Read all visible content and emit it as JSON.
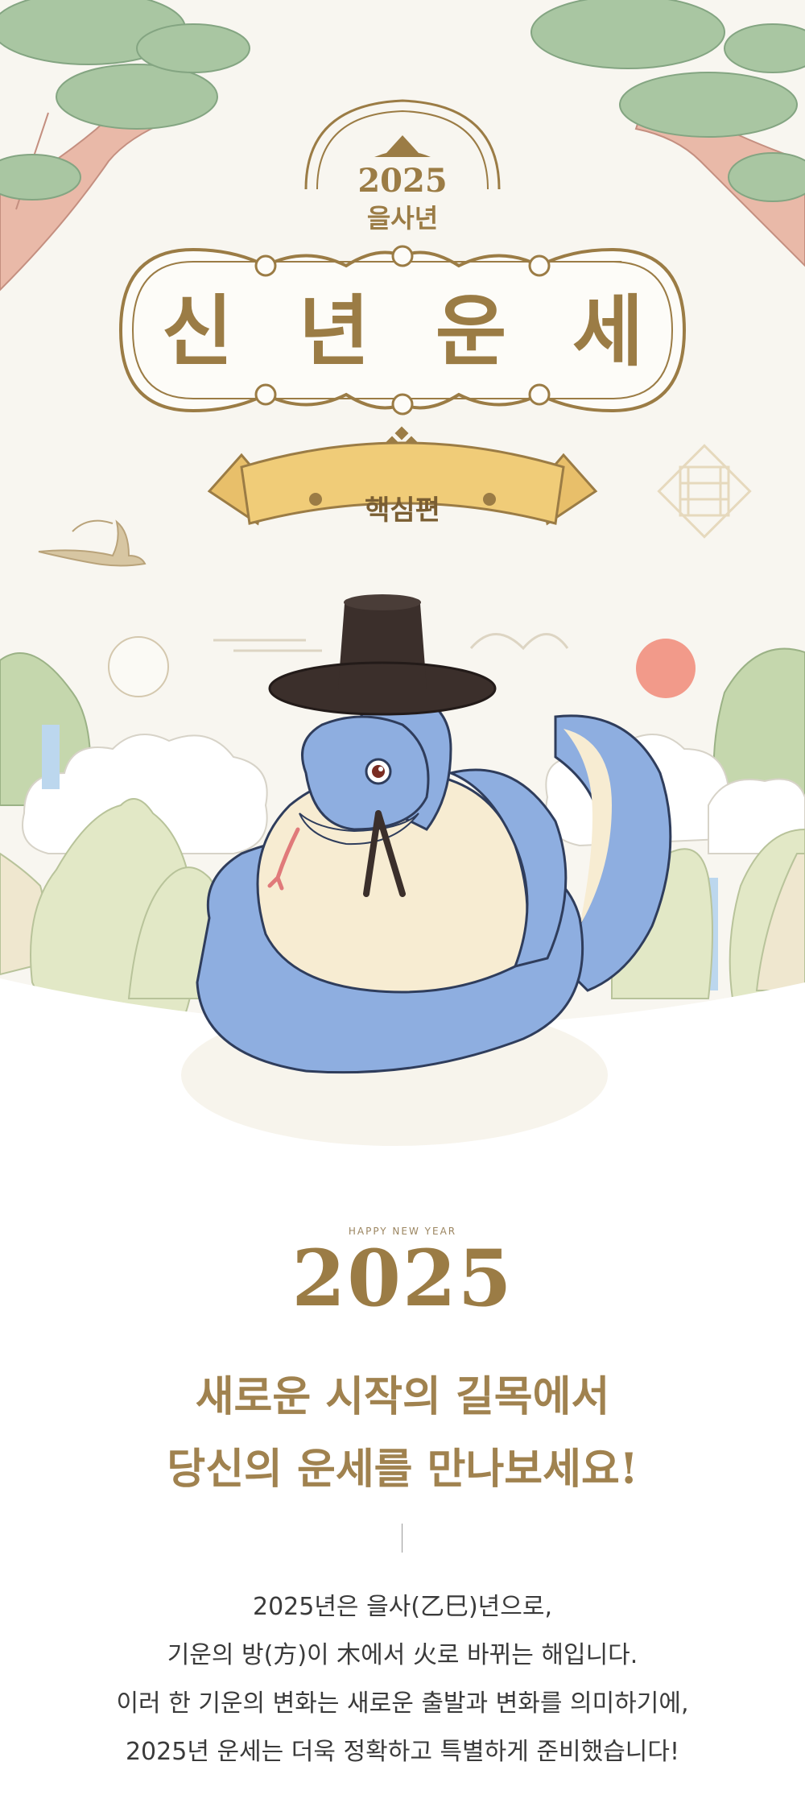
{
  "hero": {
    "year_badge": "2025",
    "zodiac_year": "을사년",
    "title_chars": [
      "신",
      "년",
      "운",
      "세"
    ],
    "ribbon_label": "핵심편"
  },
  "intro": {
    "happy_new_year": "HAPPY NEW YEAR",
    "year": "2025",
    "headline_line1": "새로운 시작의 길목에서",
    "headline_line2": "당신의 운세를 만나보세요!",
    "body_lines": [
      "2025년은 을사(乙巳)년으로,",
      "기운의 방(方)이 木에서 火로 바뀌는 해입니다.",
      "이러 한 기운의 변화는 새로운 출발과 변화를 의미하기에,",
      "2025년 운세는 더욱 정확하고 특별하게 준비했습니다!"
    ]
  },
  "colors": {
    "gold": "#9b7c45",
    "cream_background": "#f8f6f0",
    "snake_blue": "#8eaee0",
    "snake_belly": "#f7ecd2",
    "hat": "#3b2f2b",
    "sun": "#f29a8a"
  }
}
